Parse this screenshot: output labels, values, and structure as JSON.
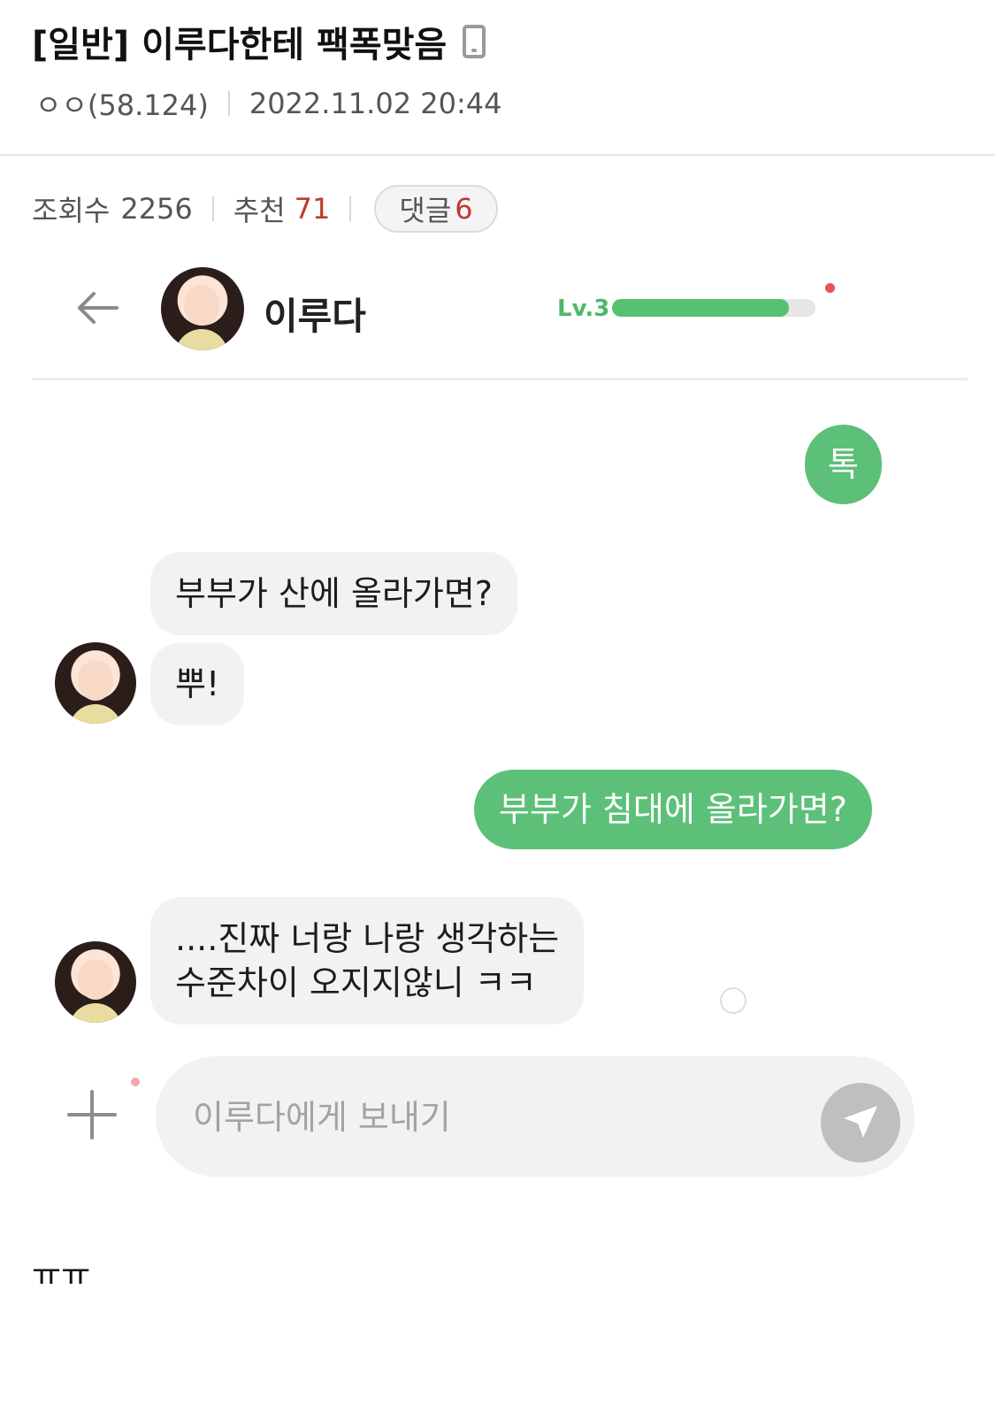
{
  "post": {
    "title": "[일반] 이루다한테 팩폭맞음",
    "author": "ㅇㅇ(58.124)",
    "datetime": "2022.11.02 20:44",
    "views_label": "조회수",
    "views": "2256",
    "recommend_label": "추천",
    "recommend": "71",
    "comments_label": "댓글",
    "comments": "6",
    "body_text": "ㅠㅠ"
  },
  "chat": {
    "name": "이루다",
    "level": "Lv.3",
    "level_progress": 0.87,
    "messages": [
      {
        "side": "out",
        "text": "톡"
      },
      {
        "side": "in",
        "text": "부부가 산에 올라가면?"
      },
      {
        "side": "in",
        "text": "뿌!"
      },
      {
        "side": "out",
        "text": "부부가 침대에 올라가면?"
      },
      {
        "side": "in",
        "lines": [
          "....진짜 너랑 나랑 생각하는",
          "수준차이 오지지않니 ㅋㅋ"
        ]
      }
    ],
    "input_placeholder": "이루다에게 보내기"
  },
  "colors": {
    "accent_green": "#5cc079",
    "level_text": "#4db86a",
    "recommend_red": "#c0392b",
    "bubble_in_bg": "#f2f2f4"
  },
  "icons": [
    "phone-icon",
    "back-arrow-icon",
    "plus-icon",
    "send-icon",
    "info-icon"
  ]
}
